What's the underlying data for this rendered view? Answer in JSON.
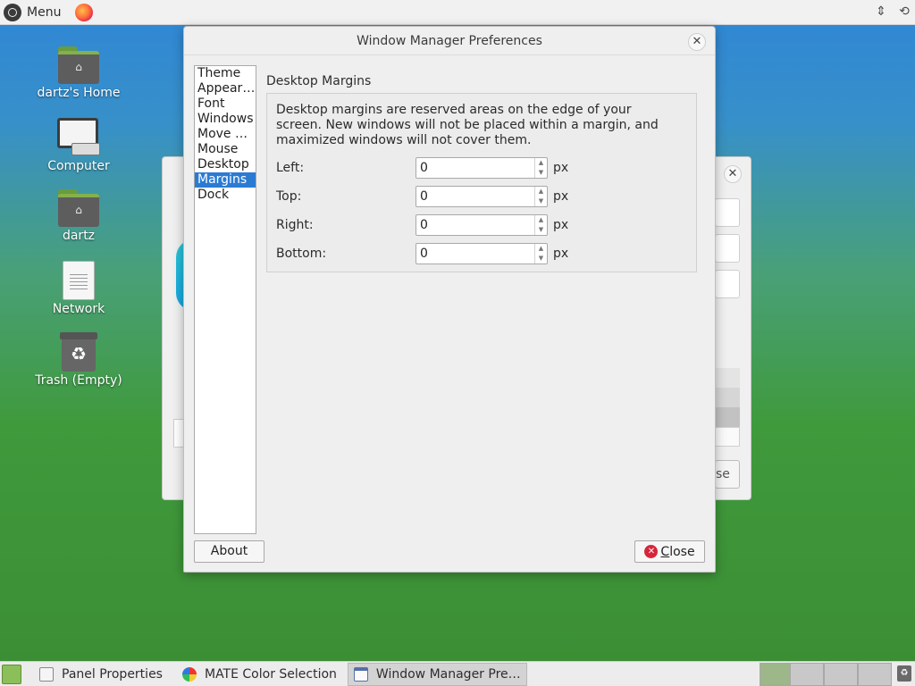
{
  "top_panel": {
    "menu_label": "Menu",
    "launcher_icon": "firefox-icon",
    "tray_icons": [
      "network-icon",
      "sync-icon"
    ]
  },
  "desktop": {
    "icons": [
      {
        "label": "dartz's Home",
        "icon": "home-folder-icon"
      },
      {
        "label": "Computer",
        "icon": "computer-icon"
      },
      {
        "label": "dartz",
        "icon": "home-folder-icon"
      },
      {
        "label": "Network",
        "icon": "network-icon"
      },
      {
        "label": "Trash (Empty)",
        "icon": "trash-icon"
      }
    ]
  },
  "background_window": {
    "button_fragment": "se",
    "close_symbol": "✕"
  },
  "dialog": {
    "title": "Window Manager Preferences",
    "close_symbol": "✕",
    "sidebar": {
      "items": [
        "Theme",
        "Appearance",
        "Font",
        "Windows",
        "Move & Resize",
        "Mouse",
        "Desktop",
        "Margins",
        "Dock"
      ],
      "selected": "Margins"
    },
    "section_title": "Desktop Margins",
    "description": "Desktop margins are reserved areas on the edge of your screen. New windows will not be placed within a margin, and maximized windows will not cover them.",
    "fields": [
      {
        "label": "Left:",
        "value": "0",
        "unit": "px"
      },
      {
        "label": "Top:",
        "value": "0",
        "unit": "px"
      },
      {
        "label": "Right:",
        "value": "0",
        "unit": "px"
      },
      {
        "label": "Bottom:",
        "value": "0",
        "unit": "px"
      }
    ],
    "about_label": "About",
    "close_label": "Close",
    "close_icon_symbol": "✕"
  },
  "bottom_panel": {
    "tasks": [
      {
        "label": "Panel Properties",
        "icon": "panel-properties-icon",
        "active": false
      },
      {
        "label": "MATE Color Selection",
        "icon": "color-wheel-icon",
        "active": false
      },
      {
        "label": "Window Manager Pre…",
        "icon": "window-manager-icon",
        "active": true
      }
    ],
    "workspaces": 4
  },
  "colors": {
    "selection": "#2b7bd3",
    "close_icon": "#d6263b"
  }
}
